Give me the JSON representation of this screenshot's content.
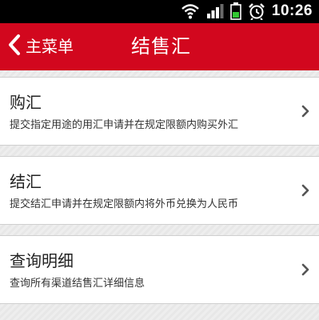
{
  "status_bar": {
    "time": "10:26",
    "icons": [
      "wifi-icon",
      "signal-icon",
      "battery-icon",
      "alarm-icon"
    ]
  },
  "header": {
    "back_label": "主菜单",
    "title": "结售汇",
    "background": "#d2071e"
  },
  "menu": {
    "items": [
      {
        "title": "购汇",
        "description": "提交指定用途的用汇申请并在规定限额内购买外汇"
      },
      {
        "title": "结汇",
        "description": "提交结汇申请并在规定限额内将外币兑换为人民币"
      },
      {
        "title": "查询明细",
        "description": "查询所有渠道结售汇详细信息"
      }
    ]
  }
}
